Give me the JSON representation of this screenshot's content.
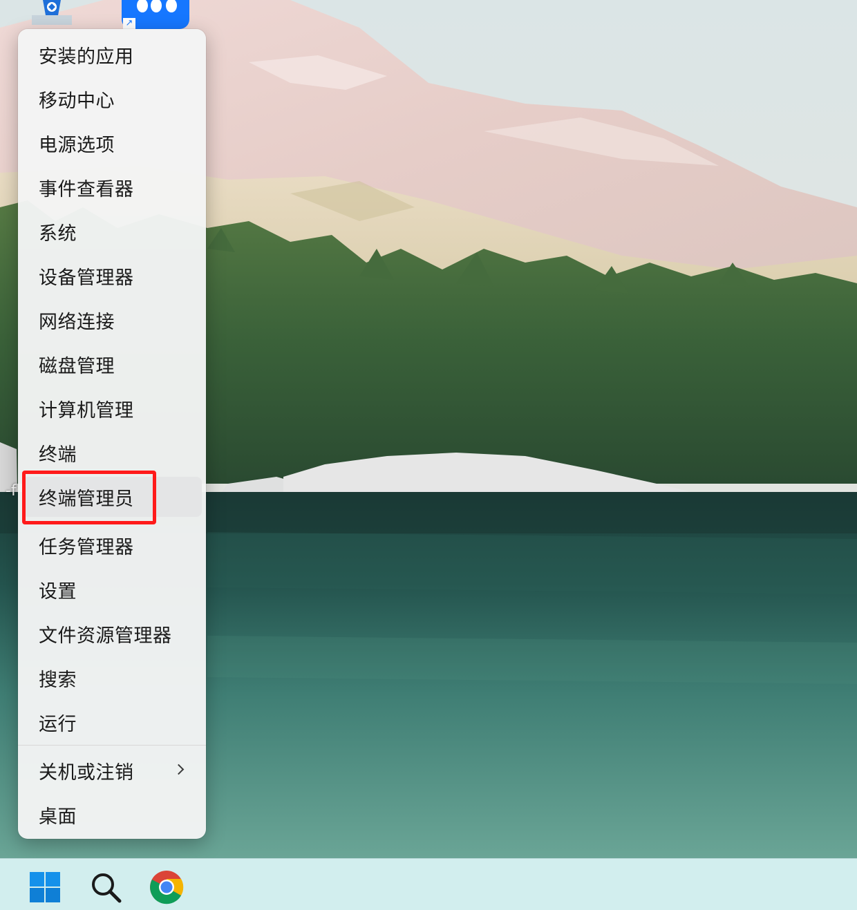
{
  "context_menu": {
    "items": [
      {
        "label": "安装的应用"
      },
      {
        "label": "移动中心"
      },
      {
        "label": "电源选项"
      },
      {
        "label": "事件查看器"
      },
      {
        "label": "系统"
      },
      {
        "label": "设备管理器"
      },
      {
        "label": "网络连接"
      },
      {
        "label": "磁盘管理"
      },
      {
        "label": "计算机管理"
      },
      {
        "label": "终端"
      },
      {
        "label": "终端管理员",
        "state": "hovered",
        "annotation": "highlighted with red box"
      },
      {
        "label": "任务管理器"
      },
      {
        "label": "设置"
      },
      {
        "label": "文件资源管理器"
      },
      {
        "label": "搜索"
      },
      {
        "label": "运行"
      },
      {
        "label": "关机或注销",
        "submenu_icon": "chevron-right-icon"
      },
      {
        "label": "桌面"
      }
    ]
  },
  "desktop": {
    "label_fragment": "-f",
    "icons": [
      "recycle-bin-icon",
      "app-shortcut-icon"
    ]
  },
  "taskbar": {
    "buttons": [
      "windows-start-icon",
      "search-icon",
      "chrome-icon"
    ]
  },
  "colors": {
    "highlight": "#ff1a1a",
    "taskbar": "#d2eeee",
    "menu_background": "#f3f4f4",
    "hover": "#e4e5e6"
  }
}
